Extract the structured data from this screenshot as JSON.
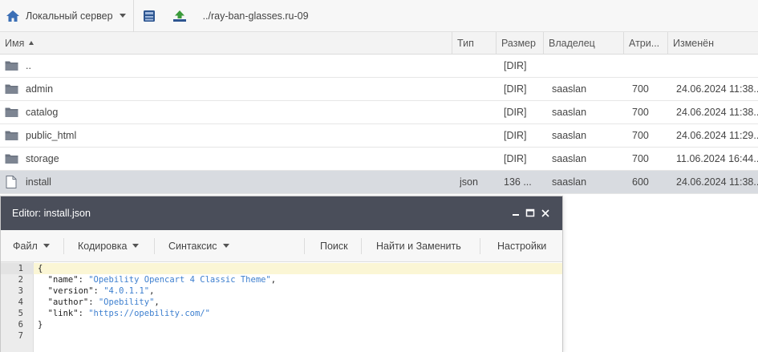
{
  "toolbar": {
    "server_label": "Локальный сервер",
    "path": "../ray-ban-glasses.ru-09",
    "icons": [
      "server-icon",
      "disk-icon",
      "upload-icon"
    ]
  },
  "columns": {
    "name": "Имя",
    "type": "Тип",
    "size": "Размер",
    "owner": "Владелец",
    "attrs": "Атри...",
    "modified": "Изменён"
  },
  "files": [
    {
      "name": "..",
      "type": "",
      "size": "[DIR]",
      "owner": "",
      "attrs": "",
      "modified": "",
      "icon": "folder-icon"
    },
    {
      "name": "admin",
      "type": "",
      "size": "[DIR]",
      "owner": "saaslan",
      "attrs": "700",
      "modified": "24.06.2024 11:38...",
      "icon": "folder-icon"
    },
    {
      "name": "catalog",
      "type": "",
      "size": "[DIR]",
      "owner": "saaslan",
      "attrs": "700",
      "modified": "24.06.2024 11:38...",
      "icon": "folder-icon"
    },
    {
      "name": "public_html",
      "type": "",
      "size": "[DIR]",
      "owner": "saaslan",
      "attrs": "700",
      "modified": "24.06.2024 11:29...",
      "icon": "folder-icon"
    },
    {
      "name": "storage",
      "type": "",
      "size": "[DIR]",
      "owner": "saaslan",
      "attrs": "700",
      "modified": "11.06.2024 16:44...",
      "icon": "folder-icon"
    },
    {
      "name": "install",
      "type": "json",
      "size": "136 ...",
      "owner": "saaslan",
      "attrs": "600",
      "modified": "24.06.2024 11:38...",
      "icon": "file-icon",
      "selected": true
    }
  ],
  "editor": {
    "title": "Editor: install.json",
    "menu": {
      "file": "Файл",
      "encoding": "Кодировка",
      "syntax": "Синтаксис",
      "search": "Поиск",
      "replace": "Найти и Заменить",
      "settings": "Настройки"
    },
    "lines": [
      "1",
      "2",
      "3",
      "4",
      "5",
      "6",
      "7"
    ],
    "code": {
      "l1": "{",
      "l2_key": "  \"name\": ",
      "l2_val": "\"Opebility Opencart 4 Classic Theme\"",
      "l3_key": "  \"version\": ",
      "l3_val": "\"4.0.1.1\"",
      "l4_key": "  \"author\": ",
      "l4_val": "\"Opebility\"",
      "l5_key": "  \"link\": ",
      "l5_val": "\"https://opebility.com/\"",
      "l6": "}",
      "l7": "",
      "comma": ","
    }
  },
  "colors": {
    "editor_title_bg": "#4a4e5a",
    "selected_row_bg": "#d8dbe0",
    "string_color": "#3d7fcf",
    "active_line_bg": "#fbf6d5"
  }
}
